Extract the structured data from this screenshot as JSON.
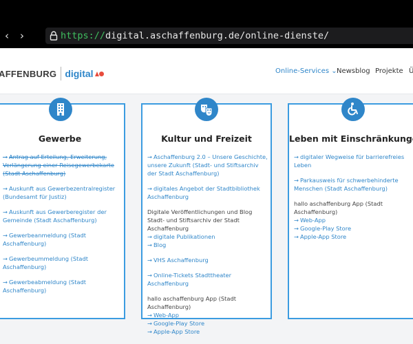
{
  "browser": {
    "back_icon": "chevron-left-icon",
    "forward_icon": "chevron-right-icon",
    "back_glyph": "‹",
    "forward_glyph": "›",
    "lock_icon": "lock-icon",
    "url_protocol": "https://",
    "url_rest": "digital.aschaffenburg.de/online-dienste/"
  },
  "header": {
    "logo_city": "AFFENBURG",
    "logo_digital": "digital",
    "nav": [
      "Online-Services ⌄",
      "Newsblog",
      "Projekte",
      "Ü"
    ]
  },
  "cards": [
    {
      "icon": "building-icon",
      "title": "Gewerbe",
      "links": [
        "Antrag auf Erteilung, Erweiterung, Verlängerung einer Reisegewerbekarte (Stadt Aschaffenburg)",
        "Auskunft aus Gewerbezentralregister (Bundesamt für Justiz)",
        "Auskunft aus Gewerberegister der Gemeinde (Stadt Aschaffenburg)",
        "Gewerbeanmeldung (Stadt Aschaffenburg)",
        "Gewerbeummeldung (Stadt Aschaffenburg)",
        "Gewerbeabmeldung (Stadt Aschaffenburg)"
      ]
    },
    {
      "icon": "theater-masks-icon",
      "title": "Kultur und Freizeit",
      "links": [
        "Aschaffenburg 2.0 – Unsere Geschichte, unsere Zukunft (Stadt- und Stiftsarchiv der Stadt Aschaffenburg)",
        "digitales Angebot der Stadtbibliothek Aschaffenburg"
      ],
      "group1_text": "Digitale Veröffentlichungen und Blog Stadt- und Stiftsarchiv der Stadt Aschaffenburg",
      "group1_links": [
        "digitale Publikationen",
        "Blog"
      ],
      "links2": [
        "VHS Aschaffenburg",
        "Online-Tickets Stadttheater Aschaffenburg"
      ],
      "group2_text": "hallo aschaffenburg App (Stadt Aschaffenburg)",
      "group2_links": [
        "Web-App",
        "Google-Play Store",
        "Apple-App Store"
      ]
    },
    {
      "icon": "wheelchair-icon",
      "title": "Leben mit Einschränkungen",
      "links": [
        "digitaler Wegweise für barrierefreies Leben",
        "Parkausweis für schwerbehinderte Menschen (Stadt Aschaffenburg)"
      ],
      "group_text": "hallo aschaffenburg App (Stadt Aschaffenburg)",
      "group_links": [
        "Web-App",
        "Google-Play Store",
        "Apple-App Store"
      ]
    }
  ],
  "colors": {
    "accent": "#2f86c9",
    "border": "#3b9be0",
    "logo_red": "#e84c3d"
  }
}
